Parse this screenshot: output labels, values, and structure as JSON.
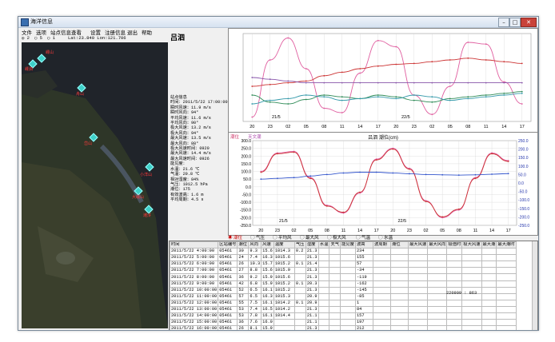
{
  "window": {
    "title": "海洋信息",
    "minimize": "–",
    "maximize": "□",
    "close": "✕"
  },
  "menu": [
    "文件",
    "选项",
    "站点信息查看",
    "设置",
    "注册信息",
    "退出",
    "帮助"
  ],
  "toolbar": {
    "opt1": "◎ 2",
    "opt2": "◯ 5",
    "opt3": "◯ 1",
    "coords": "Lat:23.840  Lon:121.706"
  },
  "map": {
    "stations": [
      {
        "label": "嵊山"
      },
      {
        "label": "嵊泗"
      },
      {
        "label": "舟山"
      },
      {
        "label": "岱山"
      },
      {
        "label": "小洋山"
      },
      {
        "label": "大戢山"
      },
      {
        "label": "滩浒"
      }
    ]
  },
  "station_name": "吕泗",
  "info": {
    "lines": [
      "站点信息",
      "时间：2011/5/22 17:00:00",
      "瞬时风速：11.9 m/s",
      "瞬时风向：94°",
      "平均风速：11.6 m/s",
      "平均风向：90°",
      "极大风速：13.2 m/s",
      "极大风向：94°",
      "最大风速：13.5 m/s",
      "最大风向：88°",
      "极大风速时间：0920",
      "最大风速：14.4 m/s",
      "最大风速时间：0926",
      "能见度：",
      "水温：21.6 ℃",
      "气温：20.8 ℃",
      "相对湿度：84%",
      "气压：1012.5 hPa",
      "潮位：175",
      "有效波高：1.6 m",
      "平均周期：4.5 s"
    ]
  },
  "chart_data": [
    {
      "type": "line",
      "title": "",
      "x": [
        "20",
        "23",
        "02",
        "05",
        "08",
        "11",
        "14",
        "17",
        "20",
        "23",
        "02",
        "05",
        "08",
        "11",
        "14",
        "17"
      ],
      "x_groups": [
        "21/5",
        "22/5"
      ],
      "series": [
        {
          "color": "#e05fa0",
          "values": [
            5,
            70,
            95,
            60,
            15,
            10,
            55,
            92,
            85,
            30,
            8,
            40,
            90,
            88,
            45,
            20
          ]
        },
        {
          "color": "#cc3333",
          "values": [
            40,
            42,
            44,
            46,
            52,
            56,
            60,
            63,
            65,
            66,
            68,
            70,
            72,
            70,
            68,
            66
          ]
        },
        {
          "color": "#2e8b57",
          "values": [
            30,
            22,
            20,
            25,
            30,
            28,
            26,
            30,
            28,
            24,
            22,
            26,
            28,
            30,
            32,
            34
          ]
        },
        {
          "color": "#3399aa",
          "values": [
            20,
            24,
            26,
            30,
            28,
            24,
            26,
            28,
            26,
            30,
            28,
            24,
            26,
            28,
            30,
            32
          ]
        },
        {
          "color": "#8855aa",
          "values": [
            50,
            48,
            46,
            44,
            44,
            44,
            44,
            44,
            44,
            44,
            44,
            44,
            44,
            44,
            44,
            44
          ]
        }
      ]
    },
    {
      "type": "line",
      "title": "吕泗  潮位(cm)",
      "legend_left": [
        "潮位",
        "天文潮"
      ],
      "x": [
        "20",
        "23",
        "02",
        "05",
        "08",
        "11",
        "14",
        "17",
        "20",
        "23",
        "02",
        "05",
        "08",
        "11",
        "14",
        "17"
      ],
      "x_groups": [
        "21/5",
        "22/5"
      ],
      "y_left": [
        "300.0",
        "250.0",
        "200.0",
        "150.0",
        "100.0",
        "50.0",
        "0.0",
        "-50.0",
        "-100.0",
        "-150.0",
        "-200.0",
        "-250.0"
      ],
      "y_right": [
        "250.0",
        "200.0",
        "150.0",
        "100.0",
        "50.0",
        "0.0",
        "-50.0",
        "-100.0",
        "-150.0",
        "-200.0",
        "-250.0"
      ],
      "ylim": [
        -250,
        300
      ],
      "series": [
        {
          "color": "#e05fa0",
          "values": [
            100,
            220,
            230,
            60,
            -120,
            -170,
            -40,
            180,
            250,
            120,
            -90,
            -200,
            -150,
            60,
            220,
            170
          ]
        },
        {
          "color": "#cc3333",
          "values": [
            95,
            215,
            225,
            55,
            -125,
            -165,
            -35,
            175,
            245,
            115,
            -95,
            -195,
            -145,
            55,
            215,
            165
          ]
        },
        {
          "color": "#3355cc",
          "values": [
            50,
            55,
            60,
            70,
            80,
            90,
            95,
            95,
            90,
            85,
            80,
            78,
            76,
            78,
            82,
            86
          ]
        }
      ]
    }
  ],
  "legend_bar": [
    "◉ 潮位",
    "◯ 气压",
    "◯ 平均风",
    "◯ 最大风",
    "◯ 极大风",
    "◯ 气温",
    "◯ 水温"
  ],
  "table": {
    "headers": [
      "时间",
      "区站编号",
      "潮位",
      "风向",
      "风速",
      "温度",
      "气压",
      "湿度",
      "水温",
      "天气",
      "能见度",
      "波高",
      "波周期",
      "潮位",
      "最大风速",
      "最大风向",
      "极值时",
      "极大风速",
      "最大潮",
      "最大潮时"
    ],
    "rows": [
      [
        "2011/5/22 4:00:00",
        "05461",
        "30",
        "9.3",
        "15.6",
        "1014.3",
        "0.2",
        "21.3",
        "",
        "",
        "",
        "234"
      ],
      [
        "2011/5/22 5:00:00",
        "05461",
        "24",
        "7.4",
        "16.3",
        "1015.6",
        "",
        "21.3",
        "",
        "",
        "",
        "155"
      ],
      [
        "2011/5/22 6:00:00",
        "05461",
        "26",
        "10.3",
        "15.7",
        "1015.2",
        "0.1",
        "21.4",
        "",
        "",
        "",
        "57"
      ],
      [
        "2011/5/22 7:00:00",
        "05461",
        "27",
        "8.8",
        "15.6",
        "1015.9",
        "",
        "21.3",
        "",
        "",
        "",
        "-34"
      ],
      [
        "2011/5/22 8:00:00",
        "05461",
        "36",
        "9.2",
        "15.9",
        "1015.6",
        "",
        "21.3",
        "",
        "",
        "",
        "-119"
      ],
      [
        "2011/5/22 9:00:00",
        "05461",
        "42",
        "6.8",
        "15.9",
        "1015.2",
        "0.1",
        "20.3",
        "",
        "",
        "",
        "-162"
      ],
      [
        "2011/5/22 10:00:00",
        "05461",
        "52",
        "6.5",
        "16.1",
        "1015.2",
        "",
        "21.3",
        "",
        "",
        "",
        "-145"
      ],
      [
        "2011/5/22 11:00:00",
        "05461",
        "57",
        "6.5",
        "16.3",
        "1015.3",
        "",
        "20.9",
        "",
        "",
        "",
        "-85"
      ],
      [
        "2011/5/22 12:00:00",
        "05461",
        "55",
        "7.5",
        "16.1",
        "1014.2",
        "0.1",
        "20.9",
        "",
        "",
        "",
        "1"
      ],
      [
        "2011/5/22 13:00:00",
        "05461",
        "53",
        "7.4",
        "16.5",
        "1014.2",
        "",
        "21.3",
        "",
        "",
        "",
        "84"
      ],
      [
        "2011/5/22 14:00:00",
        "05461",
        "53",
        "7.8",
        "16.1",
        "1014.4",
        "",
        "21.1",
        "",
        "",
        "",
        "157"
      ],
      [
        "2011/5/22 15:00:00",
        "05461",
        "36",
        "7.6",
        "16.0",
        "",
        "",
        "21.1",
        "",
        "",
        "",
        "197"
      ],
      [
        "2011/5/22 16:00:00",
        "05461",
        "26",
        "8.1",
        "15.9",
        "",
        "",
        "21.3",
        "",
        "",
        "",
        "212"
      ],
      [
        "2011/5/22 17:00:00",
        "05461",
        "23",
        "5.4",
        "15.9",
        "",
        "0.1",
        "20.8",
        "",
        "",
        "",
        "175"
      ]
    ],
    "extra_value": "220909 : 863"
  }
}
